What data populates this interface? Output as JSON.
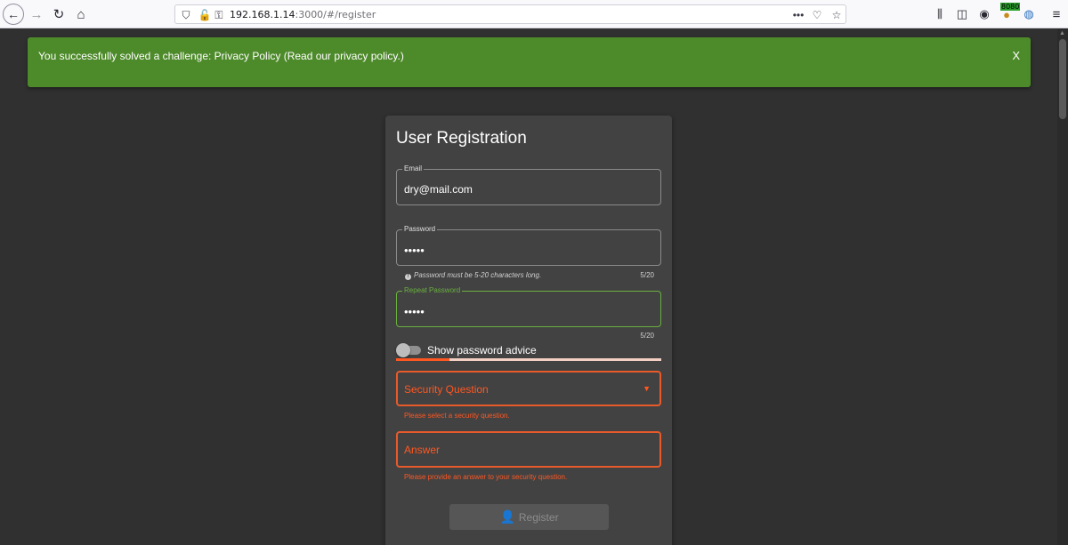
{
  "browser": {
    "url_host": "192.168.1.14",
    "url_rest": ":3000/#/register",
    "extension_badge": "8080"
  },
  "snackbar": {
    "message": "You successfully solved a challenge: Privacy Policy (Read our privacy policy.)",
    "close_label": "X"
  },
  "form": {
    "title": "User Registration",
    "email": {
      "label": "Email",
      "value": "dry@mail.com"
    },
    "password": {
      "label": "Password",
      "value": "•••••",
      "hint": "Password must be 5-20 characters long.",
      "counter": "5/20"
    },
    "repeat_password": {
      "label": "Repeat Password",
      "value": "•••••",
      "counter": "5/20"
    },
    "password_advice": {
      "label": "Show password advice",
      "enabled": false,
      "strength_fraction": 0.2
    },
    "security_question": {
      "placeholder": "Security Question",
      "error": "Please select a security question."
    },
    "answer": {
      "placeholder": "Answer",
      "error": "Please provide an answer to your security question."
    },
    "register_label": "Register"
  },
  "colors": {
    "success": "#4d8a2a",
    "valid": "#69b03f",
    "error": "#ff5722",
    "card": "#424242",
    "background": "#303030"
  }
}
